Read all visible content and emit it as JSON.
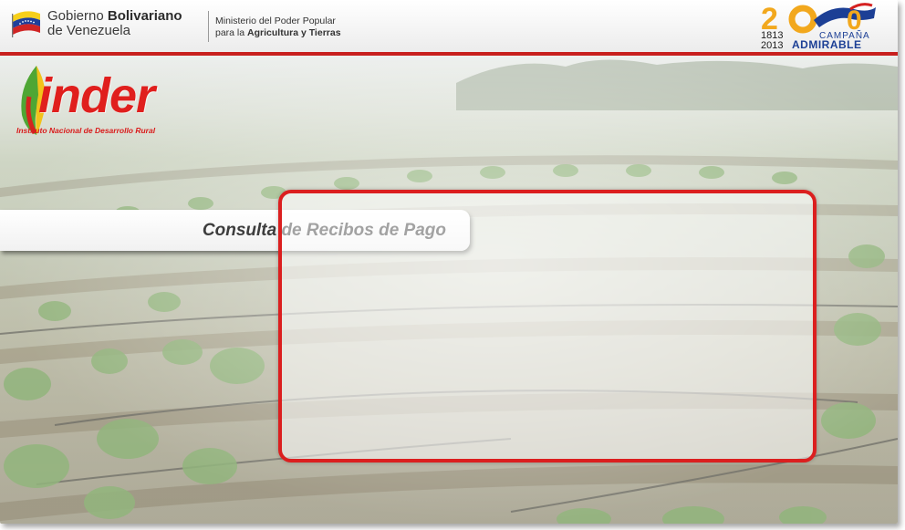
{
  "header": {
    "gov_line1_prefix": "Gobierno",
    "gov_line1_bold": "Bolivariano",
    "gov_line2": "de Venezuela",
    "ministry_line1": "Ministerio del Poder Popular",
    "ministry_line2_prefix": "para la",
    "ministry_line2_bold": "Agricultura y Tierras",
    "campaign": {
      "year_2": "2",
      "year_0": "0",
      "year_start": "1813",
      "year_end": "2013",
      "line1": "CAMPAÑA",
      "line2": "ADMIRABLE"
    }
  },
  "logo": {
    "name": "inder",
    "subtitle": "Instituto Nacional de Desarrollo Rural"
  },
  "page": {
    "title": "Consulta de Recibos de Pago"
  },
  "colors": {
    "accent_red": "#db1f1f",
    "header_border": "#c8201e"
  }
}
